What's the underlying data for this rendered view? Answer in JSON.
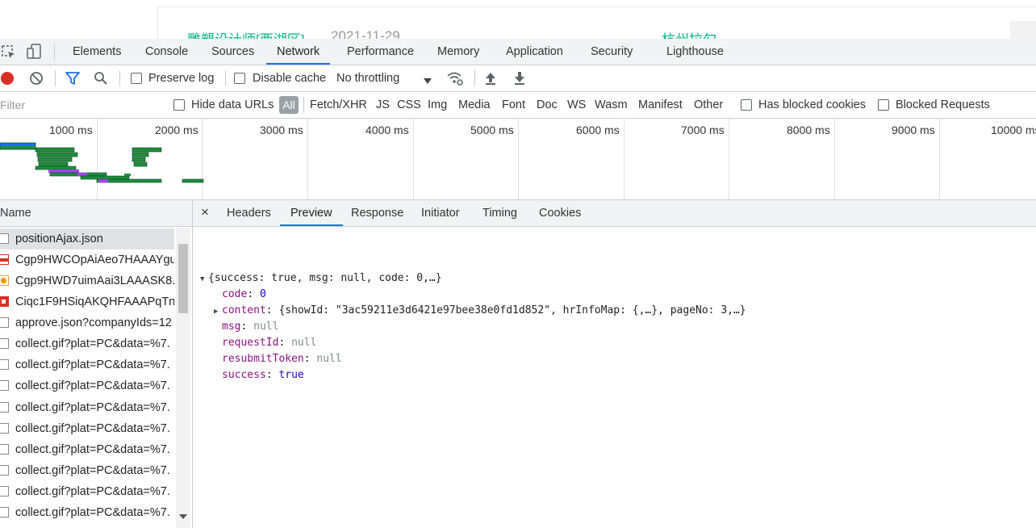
{
  "background_page": {
    "job_title": "雕塑设计师[西湖区]",
    "date": "2021-11-29",
    "right_text": "杭州拉勾"
  },
  "devtools": {
    "tabs": [
      "Elements",
      "Console",
      "Sources",
      "Network",
      "Performance",
      "Memory",
      "Application",
      "Security",
      "Lighthouse"
    ],
    "active_tab": "Network",
    "toolbar": {
      "preserve_log_label": "Preserve log",
      "disable_cache_label": "Disable cache",
      "throttling_value": "No throttling",
      "preserve_log_checked": false,
      "disable_cache_checked": false
    },
    "filter": {
      "placeholder": "Filter",
      "hide_data_urls_label": "Hide data URLs",
      "types": [
        "All",
        "Fetch/XHR",
        "JS",
        "CSS",
        "Img",
        "Media",
        "Font",
        "Doc",
        "WS",
        "Wasm",
        "Manifest",
        "Other"
      ],
      "active_type": "All",
      "has_blocked_cookies_label": "Has blocked cookies",
      "blocked_requests_label": "Blocked Requests"
    },
    "timeline_ticks": [
      "1000 ms",
      "2000 ms",
      "3000 ms",
      "4000 ms",
      "5000 ms",
      "6000 ms",
      "7000 ms",
      "8000 ms",
      "9000 ms",
      "10000 ms"
    ],
    "request_list": {
      "header": "Name",
      "rows": [
        {
          "name": "positionAjax.json",
          "icon": "document-icon",
          "selected": true
        },
        {
          "name": "Cgp9HWCOpAiAeo7HAAAYgu",
          "icon": "image-red-icon",
          "selected": false
        },
        {
          "name": "Cgp9HWD7uimAai3LAAASK8.",
          "icon": "image-orange-icon",
          "selected": false
        },
        {
          "name": "Ciqc1F9HSiqAKQHFAAAPqTnD",
          "icon": "image-red-icon",
          "selected": false
        },
        {
          "name": "approve.json?companyIds=12",
          "icon": "document-icon",
          "selected": false
        },
        {
          "name": "collect.gif?plat=PC&data=%7.",
          "icon": "document-icon",
          "selected": false
        },
        {
          "name": "collect.gif?plat=PC&data=%7.",
          "icon": "document-icon",
          "selected": false
        },
        {
          "name": "collect.gif?plat=PC&data=%7.",
          "icon": "document-icon",
          "selected": false
        },
        {
          "name": "collect.gif?plat=PC&data=%7.",
          "icon": "document-icon",
          "selected": false
        },
        {
          "name": "collect.gif?plat=PC&data=%7.",
          "icon": "document-icon",
          "selected": false
        },
        {
          "name": "collect.gif?plat=PC&data=%7.",
          "icon": "document-icon",
          "selected": false
        },
        {
          "name": "collect.gif?plat=PC&data=%7.",
          "icon": "document-icon",
          "selected": false
        },
        {
          "name": "collect.gif?plat=PC&data=%7.",
          "icon": "document-icon",
          "selected": false
        },
        {
          "name": "collect.gif?plat=PC&data=%7.",
          "icon": "document-icon",
          "selected": false
        }
      ]
    },
    "detail": {
      "close_glyph": "×",
      "tabs": [
        "Headers",
        "Preview",
        "Response",
        "Initiator",
        "Timing",
        "Cookies"
      ],
      "active_tab": "Preview",
      "preview": {
        "root_summary": "{success: true, msg: null, code: 0,…}",
        "lines": [
          {
            "key": "code",
            "value": "0",
            "type": "number"
          },
          {
            "key": "content",
            "value": "{showId: \"3ac59211e3d6421e97bee38e0fd1d852\", hrInfoMap: {,…}, pageNo: 3,…}",
            "type": "object"
          },
          {
            "key": "msg",
            "value": "null",
            "type": "null"
          },
          {
            "key": "requestId",
            "value": "null",
            "type": "null"
          },
          {
            "key": "resubmitToken",
            "value": "null",
            "type": "null"
          },
          {
            "key": "success",
            "value": "true",
            "type": "boolean"
          }
        ]
      }
    }
  }
}
